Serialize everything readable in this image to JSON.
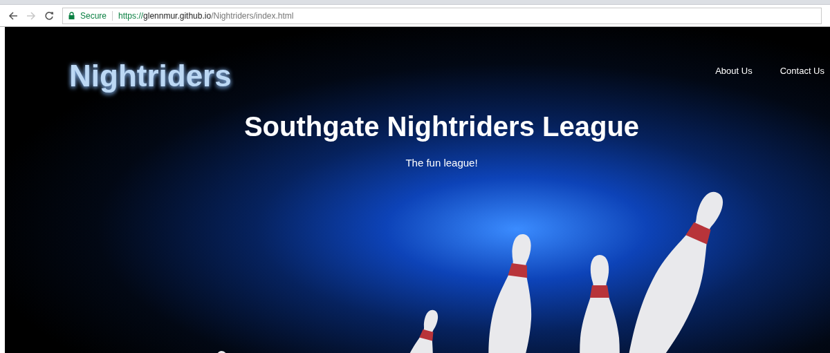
{
  "browser": {
    "security_label": "Secure",
    "url_scheme": "https://",
    "url_host": "glennmur.github.io",
    "url_path": "/Nightriders/index.html",
    "forward_disabled": true
  },
  "site": {
    "logo": "Nightriders",
    "nav": [
      {
        "label": "About Us"
      },
      {
        "label": "Contact Us"
      }
    ],
    "headline": "Southgate Nightriders League",
    "tagline": "The fun league!"
  }
}
